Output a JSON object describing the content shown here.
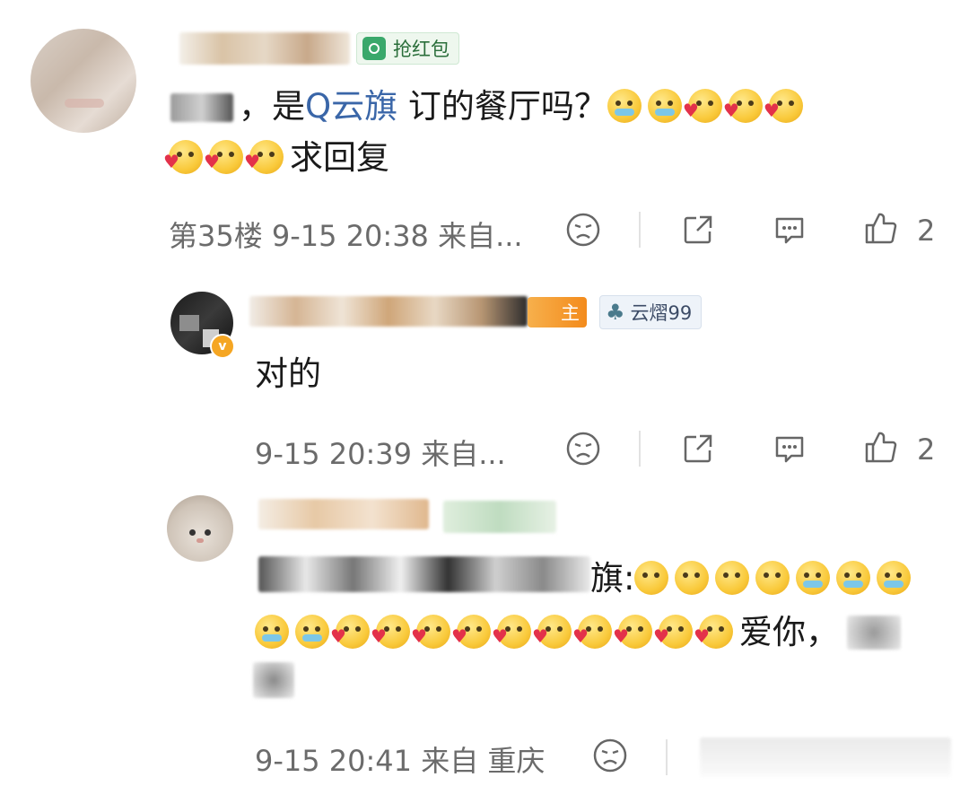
{
  "comments": [
    {
      "tag": "抢红包",
      "line1_pre": "，是",
      "line1_link": "Q云旗",
      "line1_post": " 订的餐厅吗？",
      "line2_text": "求回复",
      "meta": "第35楼  9-15 20:38  来自...",
      "likes": "2"
    },
    {
      "owner_badge": "主",
      "fan_tag": "云熠99",
      "text": "对的",
      "meta": "9-15 20:39  来自...",
      "likes": "2"
    },
    {
      "line1_suffix": "旗:",
      "line2_text": "爱你，",
      "meta": "9-15 20:41  来自 重庆"
    }
  ],
  "icons": [
    "dislike-icon",
    "share-icon",
    "comment-icon",
    "like-icon"
  ]
}
